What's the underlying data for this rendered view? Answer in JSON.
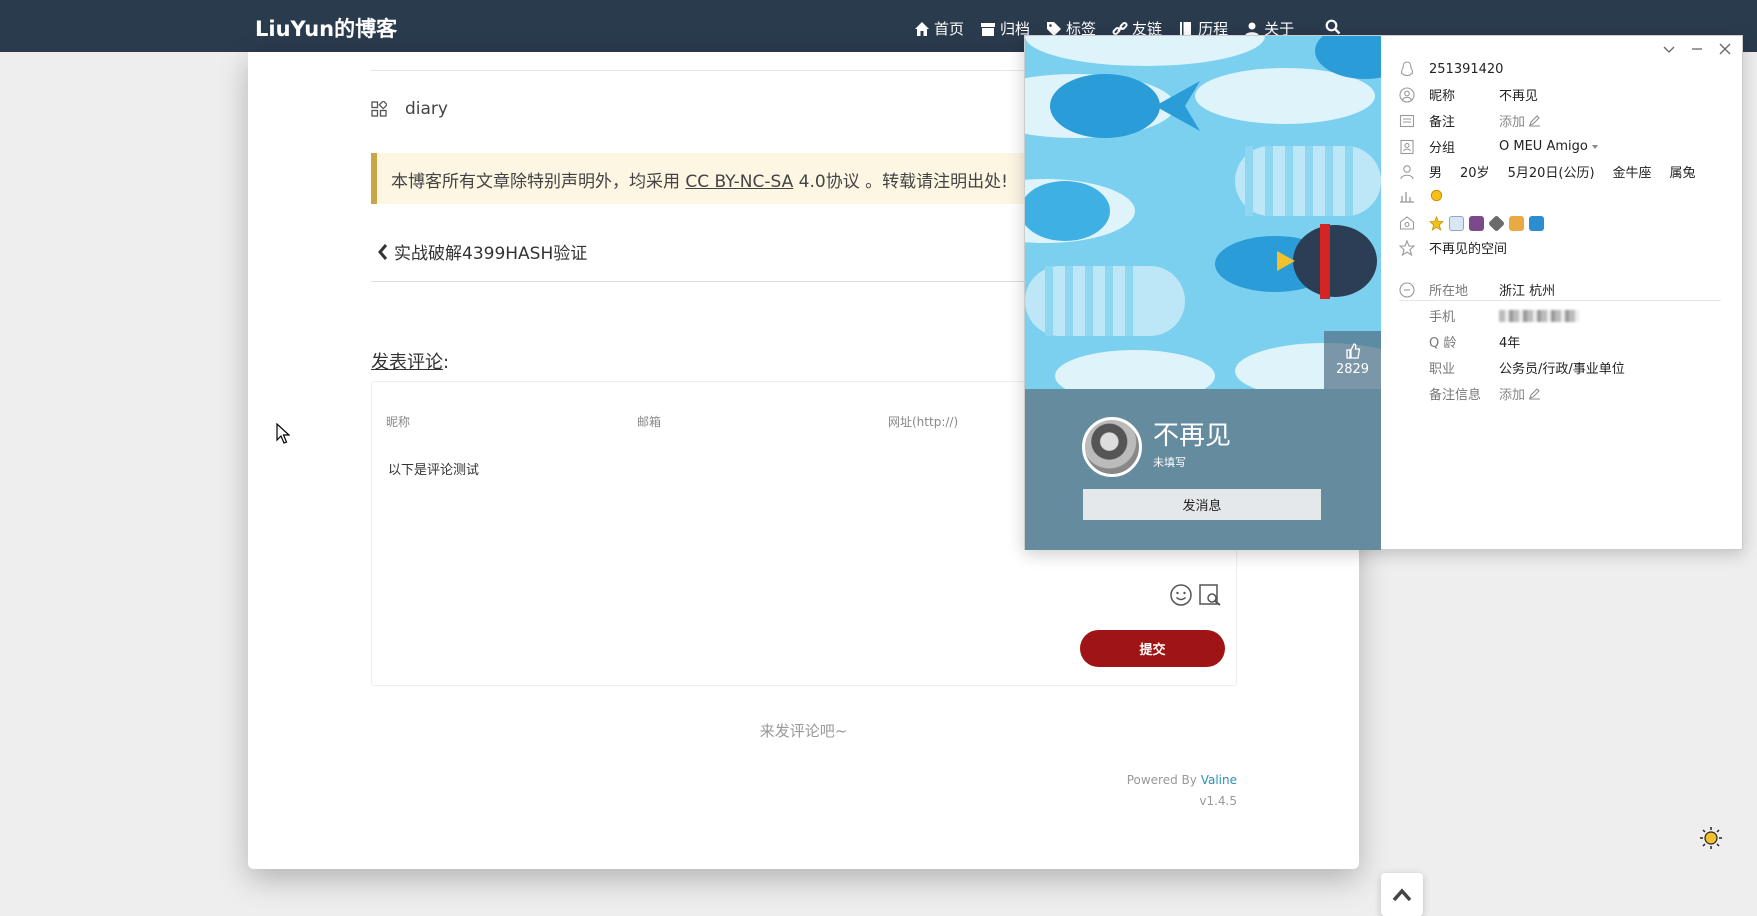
{
  "header": {
    "brand": "LiuYun的博客",
    "nav": [
      {
        "label": "首页",
        "icon": "home-icon"
      },
      {
        "label": "归档",
        "icon": "archive-icon"
      },
      {
        "label": "标签",
        "icon": "tags-icon"
      },
      {
        "label": "友链",
        "icon": "link-icon"
      },
      {
        "label": "历程",
        "icon": "book-icon"
      },
      {
        "label": "关于",
        "icon": "user-icon"
      }
    ],
    "search_icon": "search-icon"
  },
  "article": {
    "category": "diary",
    "notice_before": "本博客所有文章除特别声明外，均采用 ",
    "notice_link": "CC BY-NC-SA",
    "notice_after": " 4.0协议 。转载请注明出处!",
    "prev_post": "实战破解4399HASH验证"
  },
  "comments": {
    "title_underlined": "发表评论",
    "title_suffix": ":",
    "fields": {
      "nick": "昵称",
      "mail": "邮箱",
      "link": "网址(http://)"
    },
    "text": "以下是评论测试",
    "submit_label": "提交",
    "empty_hint": "来发评论吧~",
    "powered_by": "Powered By",
    "powered_name": "Valine",
    "version": "v1.4.5"
  },
  "profile_popup": {
    "likes": "2829",
    "name": "不再见",
    "subtitle": "未填写",
    "send_message": "发消息",
    "qq_number": "251391420",
    "rows": {
      "nick_label": "昵称",
      "nick_value": "不再见",
      "remark_label": "备注",
      "remark_value": "添加",
      "group_label": "分组",
      "group_value": "O MEU Amigo",
      "gender": "男",
      "age": "20岁",
      "birthday": "5月20日(公历)",
      "zodiac": "金牛座",
      "chinese_zodiac": "属兔",
      "space": "不再见的空间",
      "location_label": "所在地",
      "location_value": "浙江  杭州",
      "phone_label": "手机",
      "qage_label": "Q 龄",
      "qage_value": "4年",
      "job_label": "职业",
      "job_value": "公务员/行政/事业单位",
      "remark_info_label": "备注信息",
      "remark_info_value": "添加"
    }
  },
  "colors": {
    "nav_bg": "#2b3b4e",
    "submit_bg": "#9f1414",
    "notice_bg": "#fdf6e3",
    "notice_border": "#c9a648",
    "profile_panel": "#658b9e",
    "valine_link": "#2b8fb7"
  }
}
